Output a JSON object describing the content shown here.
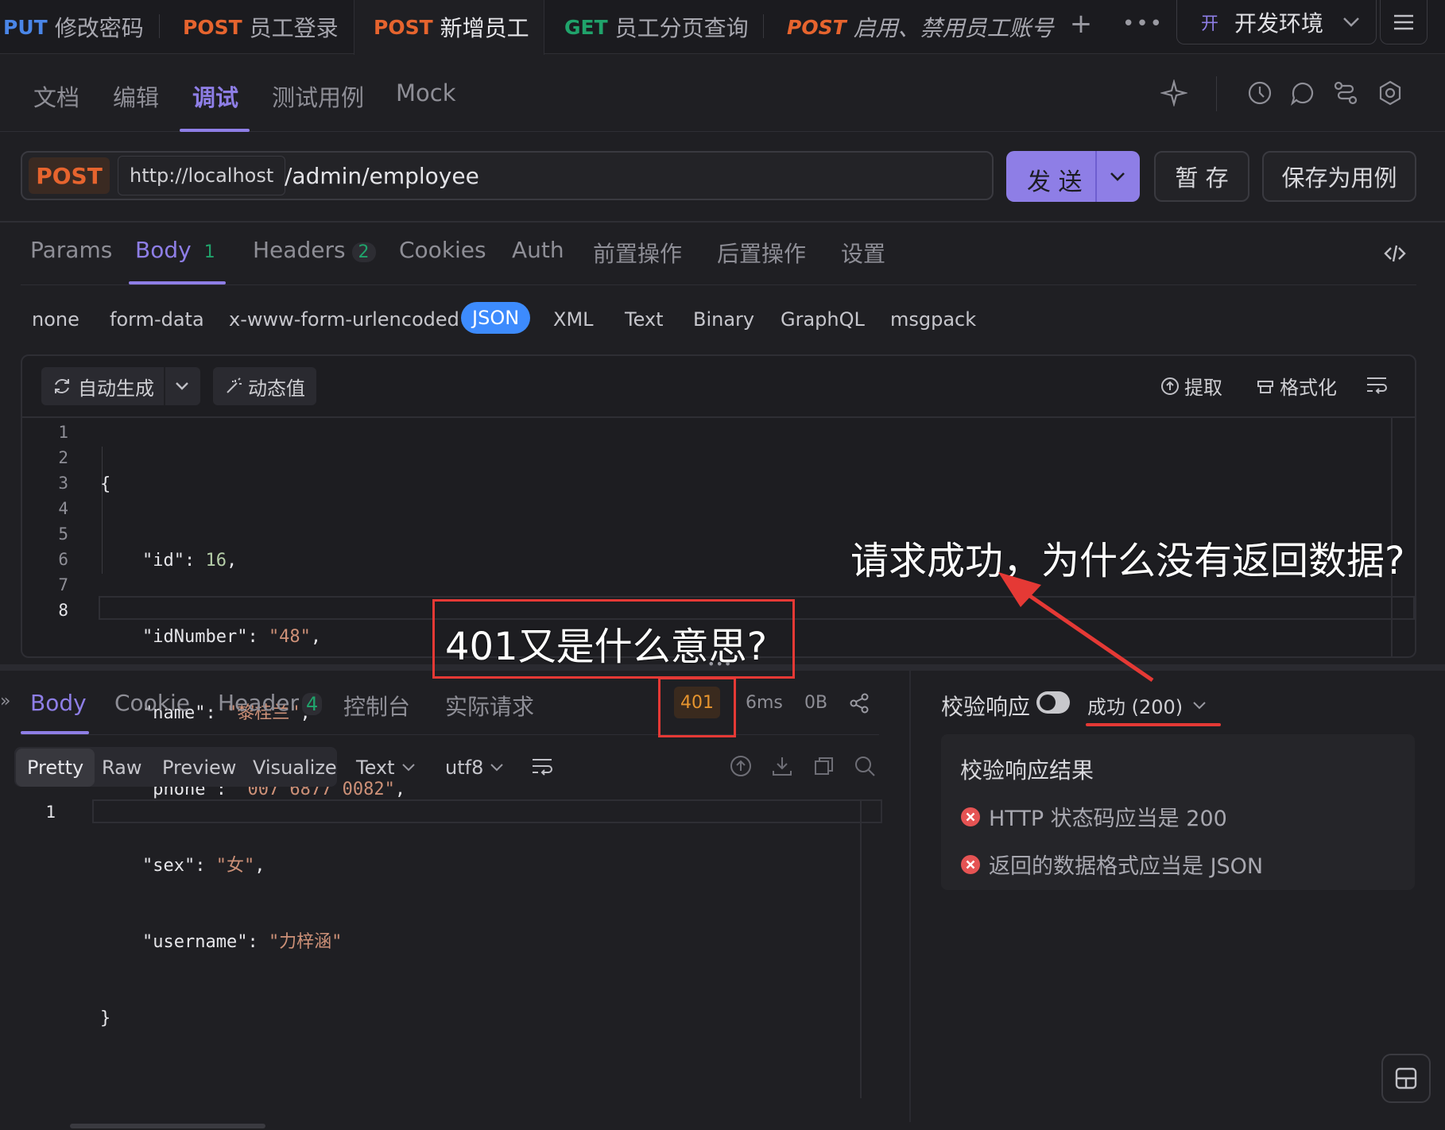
{
  "tabs": [
    {
      "method": "PUT",
      "label": "修改密码"
    },
    {
      "method": "POST",
      "label": "员工登录"
    },
    {
      "method": "POST",
      "label": "新增员工"
    },
    {
      "method": "GET",
      "label": "员工分页查询"
    },
    {
      "method": "POST",
      "label": "启用、禁用员工账号"
    }
  ],
  "env": {
    "badge": "开",
    "label": "开发环境"
  },
  "subnav": [
    "文档",
    "编辑",
    "调试",
    "测试用例",
    "Mock"
  ],
  "request": {
    "method": "POST",
    "base": "http://localhost",
    "path": "/admin/employee",
    "send": "发 送",
    "save": "暂 存",
    "save_case": "保存为用例"
  },
  "param_tabs": {
    "params": "Params",
    "body": "Body",
    "body_count": "1",
    "headers": "Headers",
    "headers_count": "2",
    "cookies": "Cookies",
    "auth": "Auth",
    "pre": "前置操作",
    "post": "后置操作",
    "settings": "设置"
  },
  "body_types": [
    "none",
    "form-data",
    "x-www-form-urlencoded",
    "JSON",
    "XML",
    "Text",
    "Binary",
    "GraphQL",
    "msgpack"
  ],
  "editor_tools": {
    "auto": "自动生成",
    "dynamic": "动态值",
    "extract": "提取",
    "format": "格式化"
  },
  "code": {
    "line_numbers": [
      "1",
      "2",
      "3",
      "4",
      "5",
      "6",
      "7",
      "8"
    ],
    "open": "{",
    "close": "}",
    "k_id": "\"id\"",
    "v_id": "16",
    "k_idNumber": "\"idNumber\"",
    "v_idNumber": "\"48\"",
    "k_name": "\"name\"",
    "v_name": "\"黎桂兰\"",
    "k_phone": "\"phone\"",
    "v_phone": "\"007 6877 0082\"",
    "k_sex": "\"sex\"",
    "v_sex": "\"女\"",
    "k_username": "\"username\"",
    "v_username": "\"力梓涵\"",
    "colon": ": ",
    "comma": ","
  },
  "response": {
    "tabs": {
      "body": "Body",
      "cookie": "Cookie",
      "header": "Header",
      "header_count": "4",
      "console": "控制台",
      "actual": "实际请求"
    },
    "status": "401",
    "time": "6ms",
    "size": "0B",
    "formats": [
      "Pretty",
      "Raw",
      "Preview",
      "Visualize"
    ],
    "text_type": "Text",
    "encoding": "utf8",
    "line1": "1"
  },
  "validate": {
    "label": "校验响应",
    "status": "成功 (200)",
    "title": "校验响应结果",
    "items": [
      "HTTP 状态码应当是 200",
      "返回的数据格式应当是 JSON"
    ]
  },
  "annotations": {
    "q1": "请求成功，为什么没有返回数据?",
    "q2": "401又是什么意思?"
  },
  "colors": {
    "accent": "#8e7ee6",
    "post": "#e6642e",
    "get": "#20a36b",
    "put": "#4a86e8",
    "error": "#e55353",
    "annotation": "#e53935",
    "json_active": "#3d8bfd"
  }
}
